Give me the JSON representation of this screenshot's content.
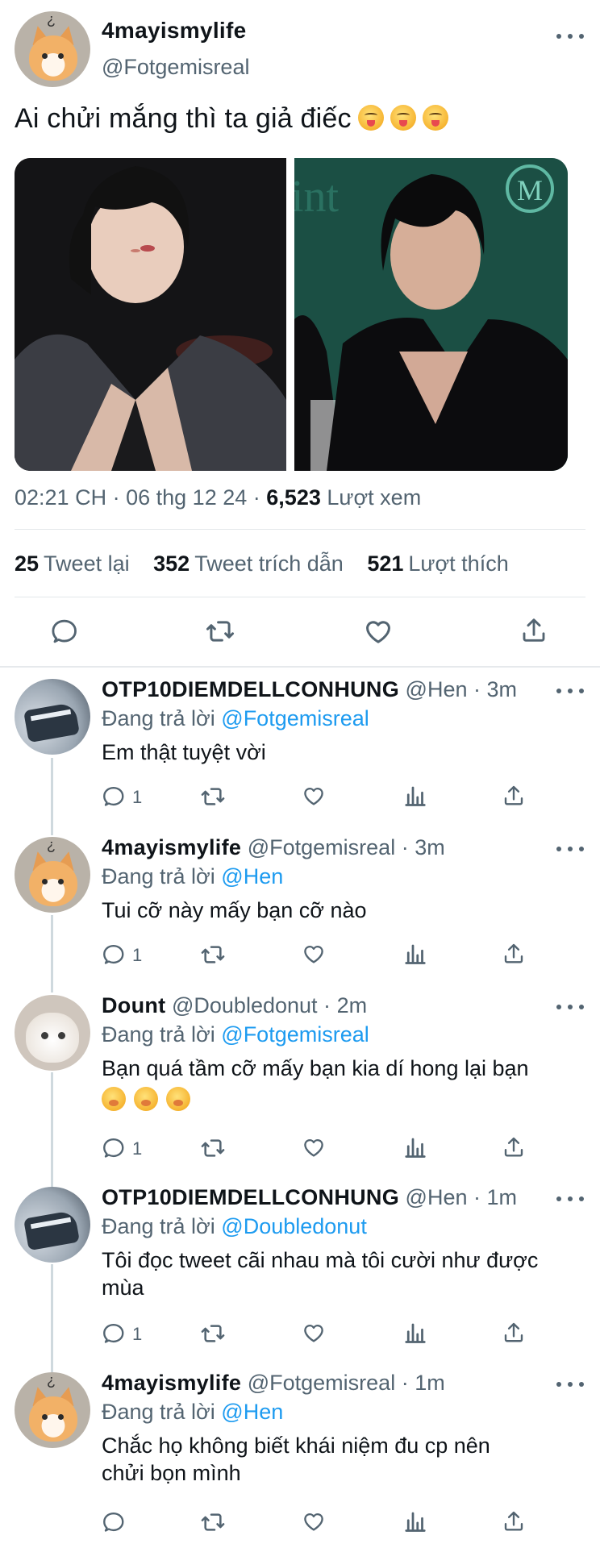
{
  "tweet": {
    "display_name": "4mayismylife",
    "handle": "@Fotgemisreal",
    "text": "Ai chửi mắng thì ta giả điếc",
    "emoji_count": 3,
    "time": "02:21 CH",
    "date": "06 thg 12 24",
    "views_count": "6,523",
    "views_label": "Lượt xem",
    "retweets_count": "25",
    "retweets_label": "Tweet lại",
    "quotes_count": "352",
    "quotes_label": "Tweet trích dẫn",
    "likes_count": "521",
    "likes_label": "Lượt thích"
  },
  "replies": [
    {
      "display_name": "OTP10DIEMDELLCONHUNG",
      "handle": "@Hen",
      "time": "3m",
      "replying_label": "Đang trả lời",
      "replying_to": "@Fotgemisreal",
      "text": "Em thật tuyệt vời",
      "reply_count": "1",
      "avatar": "shoes"
    },
    {
      "display_name": "4mayismylife",
      "handle": "@Fotgemisreal",
      "time": "3m",
      "replying_label": "Đang trả lời",
      "replying_to": "@Hen",
      "text": "Tui cỡ này mấy bạn cỡ nào",
      "reply_count": "1",
      "avatar": "cat"
    },
    {
      "display_name": "Dount",
      "handle": "@Doubledonut",
      "time": "2m",
      "replying_label": "Đang trả lời",
      "replying_to": "@Fotgemisreal",
      "text": "Bạn quá tầm cỡ mấy bạn kia dí hong lại bạn",
      "reply_count": "1",
      "avatar": "white-cat"
    },
    {
      "display_name": "OTP10DIEMDELLCONHUNG",
      "handle": "@Hen",
      "time": "1m",
      "replying_label": "Đang trả lời",
      "replying_to": "@Doubledonut",
      "text_line1": "Tôi đọc tweet cãi nhau mà tôi cười như được",
      "text_line2": "mùa",
      "reply_count": "1",
      "avatar": "shoes"
    },
    {
      "display_name": "4mayismylife",
      "handle": "@Fotgemisreal",
      "time": "1m",
      "replying_label": "Đang trả lời",
      "replying_to": "@Hen",
      "text_line1": "Chắc họ không biết khái niệm đu cp nên",
      "text_line2": "chửi bọn mình",
      "avatar": "cat"
    }
  ],
  "separator": "·",
  "icons": [
    "comment-icon",
    "retweet-icon",
    "like-icon",
    "analytics-icon",
    "share-icon",
    "more-icon"
  ],
  "colors": {
    "accent": "#1d9bf0",
    "secondary_text": "#536471",
    "primary_text": "#0f1419"
  }
}
